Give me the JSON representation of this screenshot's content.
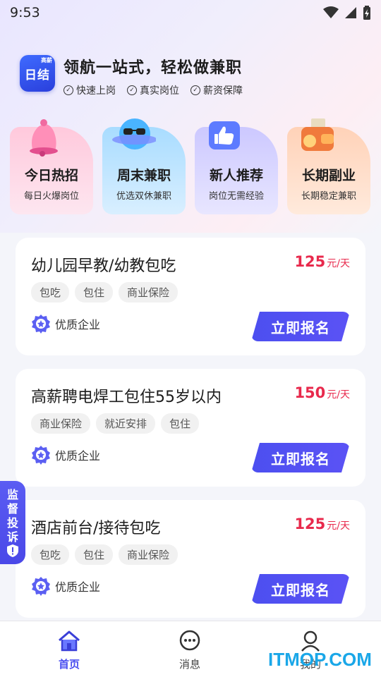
{
  "status_bar": {
    "time": "9:53"
  },
  "header": {
    "logo_text": "日结",
    "logo_tag": "高薪",
    "slogan": "领航一站式，轻松做兼职",
    "features": [
      "快速上岗",
      "真实岗位",
      "薪资保障"
    ]
  },
  "categories": [
    {
      "title": "今日热招",
      "subtitle": "每日火爆岗位",
      "icon": "bell-icon"
    },
    {
      "title": "周末兼职",
      "subtitle": "优选双休兼职",
      "icon": "planet-sunglasses-icon"
    },
    {
      "title": "新人推荐",
      "subtitle": "岗位无需经验",
      "icon": "thumbs-up-icon"
    },
    {
      "title": "长期副业",
      "subtitle": "长期稳定兼职",
      "icon": "wallet-icon"
    }
  ],
  "jobs": [
    {
      "title": "幼儿园早教/幼教包吃",
      "salary": "125",
      "unit": "元/天",
      "tags": [
        "包吃",
        "包住",
        "商业保险"
      ],
      "company": "优质企业",
      "apply": "立即报名"
    },
    {
      "title": "高薪聘电焊工包住55岁以内",
      "salary": "150",
      "unit": "元/天",
      "tags": [
        "商业保险",
        "就近安排",
        "包住"
      ],
      "company": "优质企业",
      "apply": "立即报名"
    },
    {
      "title": "酒店前台/接待包吃",
      "salary": "125",
      "unit": "元/天",
      "tags": [
        "包吃",
        "包住",
        "商业保险"
      ],
      "company": "优质企业",
      "apply": "立即报名"
    }
  ],
  "complaint": {
    "chars": [
      "监",
      "督",
      "投",
      "诉"
    ]
  },
  "tabbar": {
    "tabs": [
      {
        "label": "首页",
        "icon": "home-icon",
        "active": true
      },
      {
        "label": "消息",
        "icon": "message-icon",
        "active": false
      },
      {
        "label": "我的",
        "icon": "profile-icon",
        "active": false
      }
    ]
  },
  "watermark": "ITMOP.COM",
  "colors": {
    "accent": "#4c4ff0",
    "salary": "#e8294c"
  }
}
